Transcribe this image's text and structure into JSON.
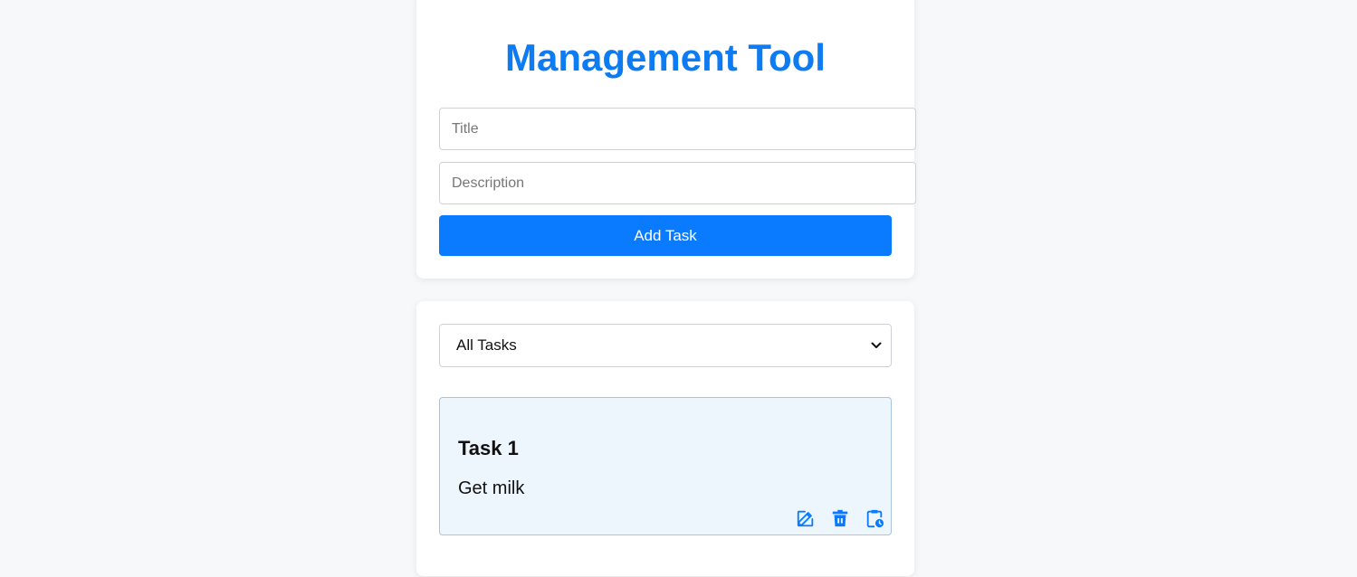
{
  "app": {
    "title": "Management Tool",
    "accent_color": "#0a7bff"
  },
  "form": {
    "title_placeholder": "Title",
    "title_value": "",
    "description_placeholder": "Description",
    "description_value": "",
    "add_button_label": "Add Task"
  },
  "filter": {
    "selected": "All Tasks"
  },
  "tasks": [
    {
      "title": "Task 1",
      "description": "Get milk",
      "actions": [
        "edit-icon",
        "trash-icon",
        "clipboard-clock-icon"
      ]
    }
  ]
}
